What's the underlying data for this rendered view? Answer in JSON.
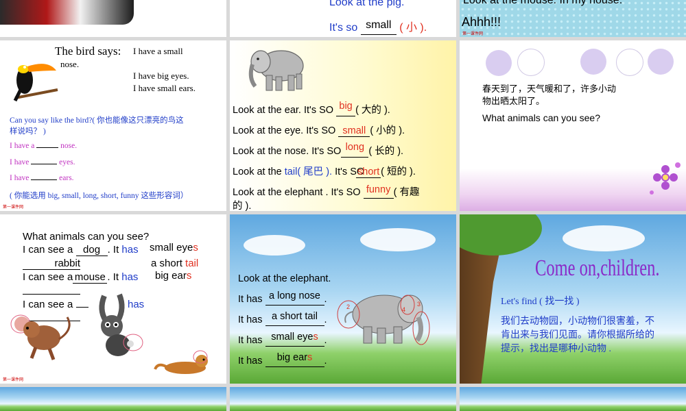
{
  "s1": {},
  "s2": {
    "line1": "Look at the pig.",
    "line2_pre": "It's so",
    "fill": "small",
    "cn": "( 小 )."
  },
  "s3": {
    "line1": "Look at the mouse. In my house.",
    "line2": "Ahhh!!!",
    "logo": "第一课件网"
  },
  "s4": {
    "title": "The bird says:",
    "b1": "I have a small",
    "b1b": "nose.",
    "b2": "I have big eyes.",
    "b3": "I have small ears.",
    "q": "Can you say like the bird?( 你也能像这只漂亮的鸟这",
    "q2": "样说吗？ )",
    "l1a": "I have a",
    "l1b": "nose.",
    "l2a": "I have",
    "l2b": "eyes.",
    "l3a": "I have",
    "l3b": "ears.",
    "hint": "( 你能选用 big, small, long, short, funny 这些形容词）",
    "logo": "第一课件网"
  },
  "s5": {
    "rows": [
      {
        "pre": "Look at the ear. It's SO",
        "fill": "big",
        "cn": "( 大的 )."
      },
      {
        "pre": "Look at the eye. It's SO",
        "fill": "small",
        "cn": "( 小的 )."
      },
      {
        "pre": "Look at the nose. It's SO",
        "fill": "long",
        "cn": "( 长的 )."
      },
      {
        "pre": "Look at the",
        "tail": "tail",
        "tailcn": "( 尾巴 ).",
        "mid": "It's SO",
        "fill": "short",
        "cn": "( 短的 )."
      },
      {
        "pre": "Look at the elephant . It's SO",
        "fill": "funny",
        "cn": "( 有趣"
      }
    ],
    "last": "的 )."
  },
  "s6": {
    "cn1": "春天到了，天气暖和了，许多小动",
    "cn2": "物出晒太阳了。",
    "q": "What animals can you see?"
  },
  "s7": {
    "q": "What animals can you see?",
    "r1a": "I can see a",
    "r1f": "dog",
    "r1b": ". It",
    "r1h": "has",
    "r1c": "small eye",
    "r1s": "s",
    "r2f": "rabbit",
    "r2c": "a short",
    "r2t": "tail",
    "r3a": "I can see a",
    "r3f": "mouse",
    "r3b": ". It",
    "r3h": "has",
    "r3c": "big ear",
    "r3s": "s",
    "r4a": "I can see a",
    "r4h": "has",
    "logo": "第一课件网"
  },
  "s8": {
    "title": "Look at the elephant.",
    "rows": [
      {
        "pre": "It has",
        "fill": "a long nose",
        "end": "."
      },
      {
        "pre": "It has",
        "fill": "a short tail",
        "end": "."
      },
      {
        "pre": "It has",
        "fill": "small eye",
        "s": "s",
        "end": "."
      },
      {
        "pre": "It has",
        "fill": "big ear",
        "s": "s",
        "end": "."
      }
    ],
    "n1": "2",
    "n2": "4",
    "n3": "3"
  },
  "s9": {
    "title": "Come on,children.",
    "find": "Let's find ( 找一找 )",
    "p1": "我们去动物园，小动物们很害羞，不",
    "p2": "肯出来与我们见面。请你根据所给的",
    "p3": "提示，找出是哪种小动物 ."
  }
}
